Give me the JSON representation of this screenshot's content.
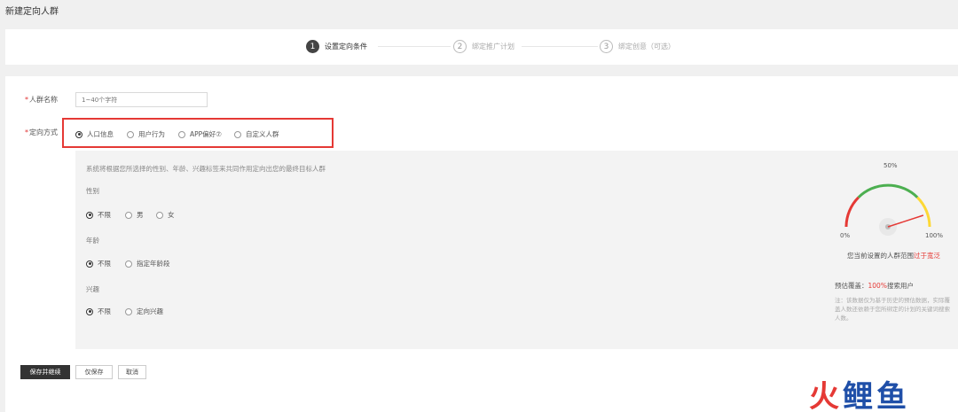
{
  "page_title": "新建定向人群",
  "steps": [
    {
      "num": "1",
      "label": "设置定向条件"
    },
    {
      "num": "2",
      "label": "绑定推广计划"
    },
    {
      "num": "3",
      "label": "绑定创意（可选）"
    }
  ],
  "form": {
    "name_label": "人群名称",
    "name_placeholder": "1~40个字符",
    "method_label": "定向方式",
    "methods": [
      "人口信息",
      "用户行为",
      "APP偏好⑦",
      "自定义人群"
    ],
    "selected_method": "人口信息"
  },
  "panel": {
    "description": "系统将根据您所选择的性别、年龄、兴趣标签来共同作用定向出您的最终目标人群",
    "sections": [
      {
        "label": "性别",
        "options": [
          "不限",
          "男",
          "女"
        ],
        "selected": "不限"
      },
      {
        "label": "年龄",
        "options": [
          "不限",
          "指定年龄段"
        ],
        "selected": "不限"
      },
      {
        "label": "兴趣",
        "options": [
          "不限",
          "定向兴趣"
        ],
        "selected": "不限"
      }
    ]
  },
  "gauge": {
    "top_label": "50%",
    "min_label": "0%",
    "max_label": "100%",
    "level_percent": 90,
    "status_text": "您当前设置的人群范围",
    "status_warn": "过于宽泛",
    "coverage_prefix": "预估覆盖：",
    "coverage_value": "100%",
    "coverage_suffix": "搜索用户",
    "note": "注：该数据仅为基于历史的预估数据，实际覆盖人数还依赖于您所绑定的计划的关键词搜索人数。",
    "colors": {
      "low": "#e53935",
      "mid": "#4caf50",
      "high": "#fdd835",
      "needle": "#e53935"
    }
  },
  "buttons": {
    "save_continue": "保存并继续",
    "save_only": "仅保存",
    "cancel": "取消"
  },
  "watermark": {
    "part1": "火",
    "part2": "鲤鱼"
  }
}
